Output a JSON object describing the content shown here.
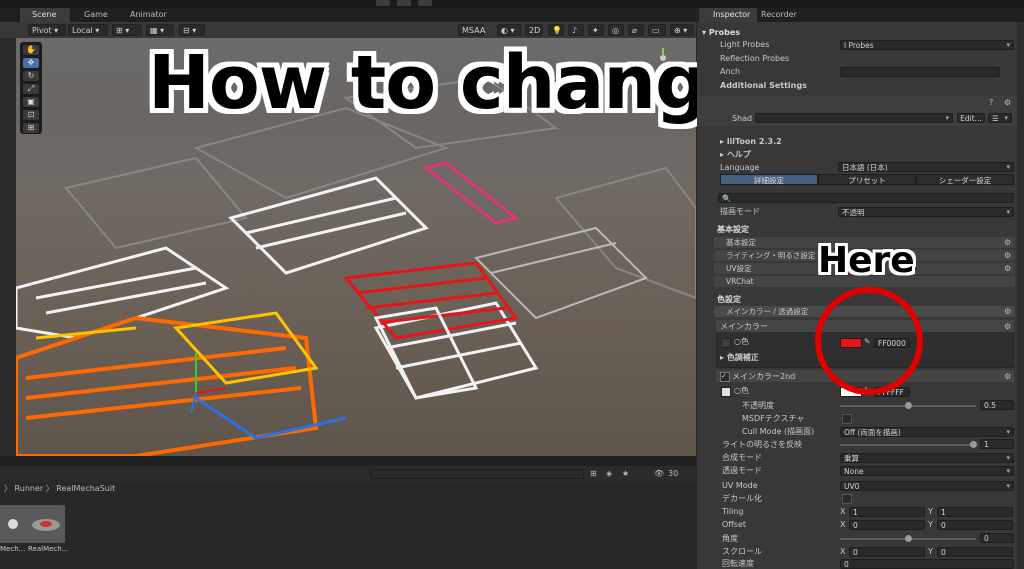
{
  "thumbnail": {
    "title": "How to change color",
    "callout": "Here"
  },
  "scene_panel": {
    "tabs": [
      "Scene",
      "Game",
      "Animator"
    ],
    "pivot": "Pivot",
    "local": "Local",
    "msaa": "MSAA",
    "mode_2d": "2D",
    "gizmo_count": "30"
  },
  "project_panel": {
    "breadcrumb_runner": "Runner",
    "breadcrumb_current": "RealMechaSuit",
    "assets": [
      "Mech...",
      "RealMech..."
    ]
  },
  "inspector": {
    "tabs": [
      "Inspector",
      "Recorder"
    ],
    "probes": {
      "header": "Probes",
      "light_probes_label": "Light Probes",
      "light_probes_value": "l Probes",
      "reflection_probes_label": "Reflection Probes",
      "anchor_label": "Anch"
    },
    "additional_settings": "Additional Settings",
    "material": {
      "shader_label": "Shad",
      "edit_button": "Edit..."
    },
    "liltoon": {
      "version": "lilToon 2.3.2",
      "help": "ヘルプ",
      "language_label": "Language",
      "language_value": "日本語 (日本)",
      "mode_tabs": [
        "詳細設定",
        "プリセット",
        "シェーダー設定"
      ],
      "render_mode_label": "描画モード",
      "render_mode_value": "不透明",
      "basic_header": "基本設定",
      "sections": [
        "基本設定",
        "ライティング・明るさ設定",
        "UV設定",
        "VRChat"
      ],
      "color_header": "色設定",
      "color_section": "メインカラー / 透過設定",
      "main_color_group": "メインカラー",
      "color_label": "色",
      "main_color_hex": "FF0000",
      "main_color_swatch": "#e8141a",
      "color_correction": "色調補正",
      "main_color_2nd": "メインカラー2nd",
      "color2_hex": "FFFFFF",
      "opacity_label": "不透明度",
      "opacity_value": "0.5",
      "opacity_fraction": 0.5,
      "msdf_label": "MSDFテクスチャ",
      "cull_label": "Cull Mode (描画面)",
      "cull_value": "Off (両面を描画)",
      "light_invert_label": "ライトの明るさを反映",
      "light_invert_value": "1",
      "blend_label": "合成モード",
      "blend_value": "乗算",
      "transparency_label": "透過モード",
      "transparency_value": "None",
      "uv_mode_label": "UV Mode",
      "uv_mode_value": "UV0",
      "decal_label": "デカール化",
      "tiling_label": "Tiling",
      "tiling_x": "1",
      "tiling_y": "1",
      "offset_label": "Offset",
      "offset_x": "0",
      "offset_y": "0",
      "angle_label": "角度",
      "angle_value": "0",
      "scroll_label": "スクロール",
      "scroll_x": "0",
      "scroll_y": "0",
      "rotation_label": "回転速度",
      "rotation_value": "0",
      "axis_x": "X",
      "axis_y": "Y"
    }
  }
}
